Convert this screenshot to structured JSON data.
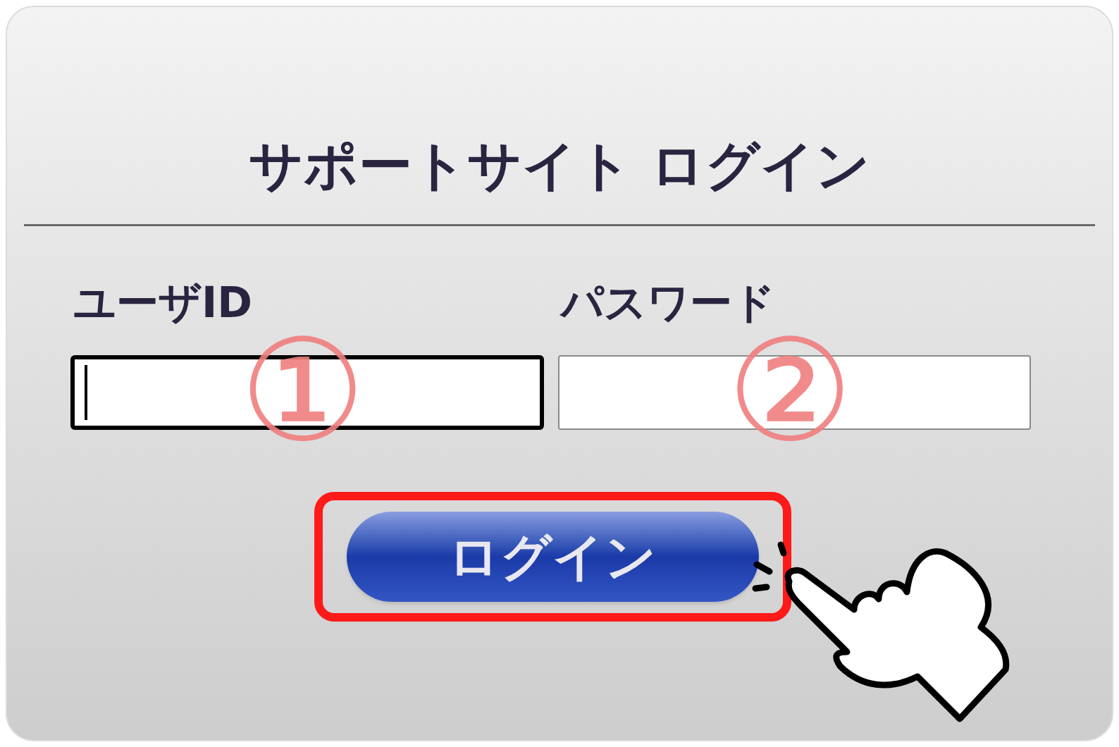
{
  "title": "サポートサイト ログイン",
  "fields": [
    {
      "label": "ユーザID",
      "focused": true,
      "marker": "①"
    },
    {
      "label": "パスワード",
      "focused": false,
      "marker": "②"
    }
  ],
  "login_button": {
    "label": "ログイン",
    "highlighted": true
  }
}
